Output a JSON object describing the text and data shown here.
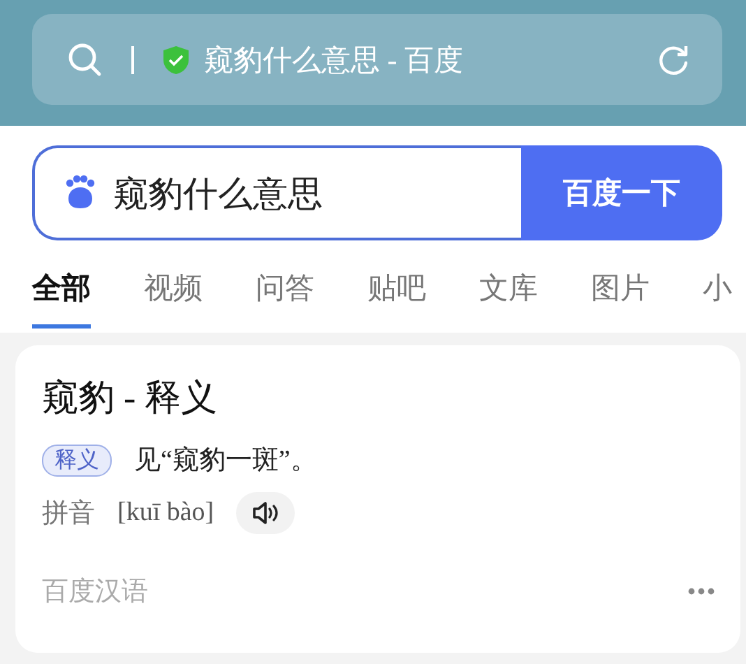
{
  "address_bar": {
    "title": "窥豹什么意思 - 百度"
  },
  "search": {
    "value": "窥豹什么意思",
    "button": "百度一下"
  },
  "tabs": [
    {
      "label": "全部",
      "selected": true
    },
    {
      "label": "视频",
      "selected": false
    },
    {
      "label": "问答",
      "selected": false
    },
    {
      "label": "贴吧",
      "selected": false
    },
    {
      "label": "文库",
      "selected": false
    },
    {
      "label": "图片",
      "selected": false
    },
    {
      "label": "小",
      "selected": false
    }
  ],
  "result": {
    "title": "窥豹 - 释义",
    "tag": "释义",
    "definition": "见“窥豹一斑”。",
    "pinyin_label": "拼音",
    "pinyin": "[kuī bào]",
    "source": "百度汉语"
  }
}
